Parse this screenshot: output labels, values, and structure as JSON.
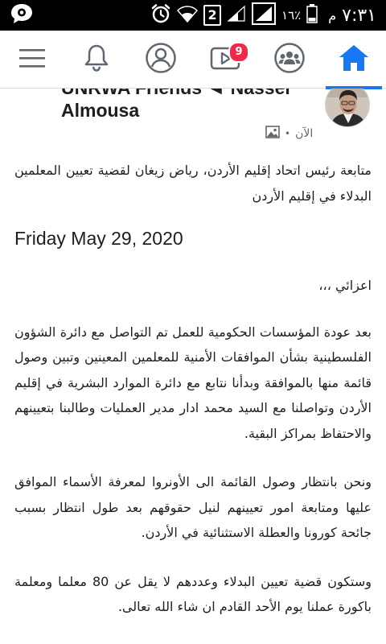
{
  "status_bar": {
    "time": "٧:٣١",
    "ampm": "م",
    "battery_percent": "١٦٪",
    "sim_label": "2",
    "icons": [
      "facebook-messenger-icon",
      "alarm-icon",
      "wifi-icon",
      "sim-2-icon",
      "signal-icon",
      "battery-icon"
    ]
  },
  "nav": {
    "items": [
      "menu-icon",
      "bell-icon",
      "profile-icon",
      "watch-icon",
      "groups-icon",
      "home-icon"
    ],
    "watch_badge": "9",
    "active": "home",
    "accent_color": "#1877f2",
    "badge_color": "#f02849"
  },
  "post": {
    "author_line1": "UNRWA Friends ◄ Nasser",
    "author_line2": "Almousa",
    "time": "الآن",
    "dot": "•",
    "intro": "متابعة رئيس اتحاد إقليم الأردن، رياض زيغان لقضية تعيين المعلمين البدلاء في إقليم الأردن",
    "date": "Friday May 29, 2020",
    "greeting": "اعزائي ،،،",
    "paragraph1": "بعد عودة المؤسسات الحكومية للعمل تم التواصل مع دائرة الشؤون الفلسطينية بشأن الموافقات الأمنية للمعلمين المعينين وتبين وصول قائمة منها بالموافقة وبدأنا نتابع مع دائرة الموارد البشرية في إقليم الأردن وتواصلنا مع السيد محمد ادار مدير العمليات وطالبنا بتعيينهم والاحتفاظ بمراكز البقية.",
    "paragraph2": "ونحن بانتظار وصول القائمة الى الأونروا لمعرفة الأسماء الموافق عليها ومتابعة امور تعيينهم لنيل حقوقهم بعد طول انتظار بسبب جائحة كورونا والعطلة الاستثنائية في الأردن.",
    "paragraph3": "وستكون قضية تعيين البدلاء وعددهم لا يقل عن 80 معلما ومعلمة باكورة عملنا يوم الأحد القادم ان شاء الله تعالى."
  }
}
